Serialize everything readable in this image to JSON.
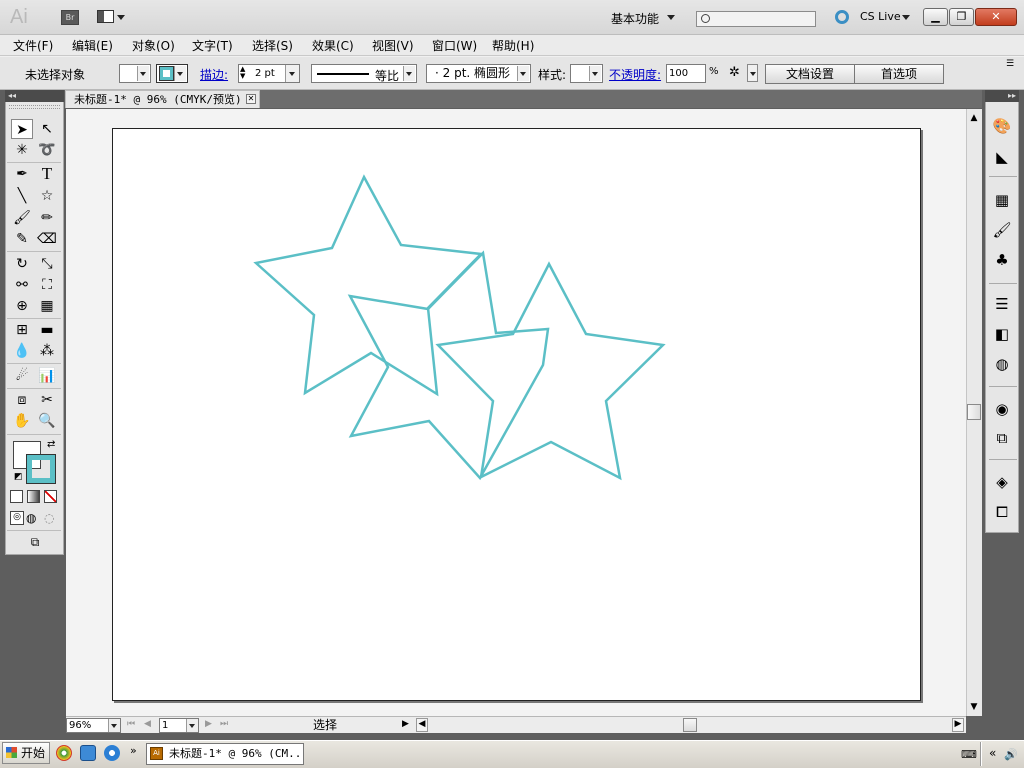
{
  "app": {
    "logo": "Ai",
    "bridge_label": "Br",
    "workspace": "基本功能",
    "search_placeholder": "",
    "cs_live": "CS Live",
    "window_buttons": {
      "minimize": "▁",
      "maximize": "❐",
      "close": "✕"
    }
  },
  "menu": {
    "items": [
      "文件(F)",
      "编辑(E)",
      "对象(O)",
      "文字(T)",
      "选择(S)",
      "效果(C)",
      "视图(V)",
      "窗口(W)",
      "帮助(H)"
    ]
  },
  "control_bar": {
    "selection_status": "未选择对象",
    "stroke_label": "描边:",
    "stroke_weight": "2 pt",
    "stroke_profile": "等比",
    "brush": "· 2 pt. 椭圆形",
    "style_label": "样式:",
    "opacity_label": "不透明度:",
    "opacity_value": "100",
    "opacity_unit": "%",
    "doc_setup_button": "文档设置",
    "preferences_button": "首选项"
  },
  "document": {
    "tab_title": "未标题-1* @ 96% (CMYK/预览)",
    "tab_close": "✕"
  },
  "canvas": {
    "stroke_color": "#5bbfc6",
    "fill_color": "#ffffff",
    "shapes": [
      {
        "type": "star",
        "name": "star-1"
      },
      {
        "type": "star",
        "name": "star-2"
      },
      {
        "type": "star",
        "name": "star-3"
      }
    ]
  },
  "status_bar": {
    "zoom": "96%",
    "page": "1",
    "status": "选择"
  },
  "taskbar": {
    "start": "开始",
    "task_label": "未标题-1* @ 96% (CM..."
  },
  "colors": {
    "accent_stroke": "#5bbfc6",
    "panel_bg": "#e6e6e6",
    "workspace_bg": "#5e5e5e"
  }
}
